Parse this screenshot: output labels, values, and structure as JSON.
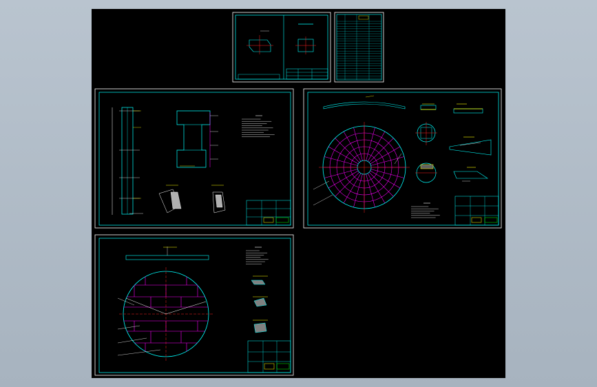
{
  "viewer": {
    "canvas_background": "#000000",
    "frame_background": "#b4bfcb",
    "line_colors": {
      "frame": "#00ffff",
      "outline": "#00ffff",
      "grid": "#ff00ff",
      "center": "#ff2020",
      "dimension": "#ffff00",
      "text": "#ffffff",
      "hatch": "#00ff00"
    }
  },
  "sheets": [
    {
      "id": "sheet-small-layout",
      "title": "",
      "labels": []
    },
    {
      "id": "sheet-parts-list",
      "title": "",
      "labels": []
    },
    {
      "id": "sheet-column-elevation",
      "title": "",
      "labels": []
    },
    {
      "id": "sheet-radial-plate",
      "title": "",
      "labels": []
    },
    {
      "id": "sheet-grid-plate",
      "title": "",
      "labels": []
    }
  ]
}
